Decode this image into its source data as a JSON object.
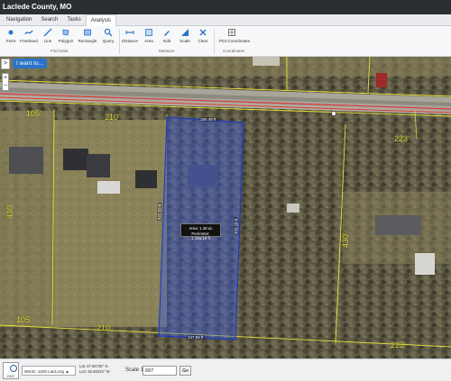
{
  "app": {
    "title": "Laclede County, MO"
  },
  "nav": {
    "tabs": [
      "Navigation",
      "Search",
      "Tasks",
      "Analysis"
    ],
    "active": "Analysis"
  },
  "ribbon": {
    "tools": [
      {
        "label": "Point",
        "icon": "point-icon"
      },
      {
        "label": "Freehand",
        "icon": "freehand-icon"
      },
      {
        "label": "Line",
        "icon": "line-icon"
      },
      {
        "label": "Polygon",
        "icon": "polygon-icon"
      },
      {
        "label": "Rectangle",
        "icon": "rectangle-icon"
      },
      {
        "label": "Query",
        "icon": "query-icon"
      },
      {
        "label": "Distance",
        "icon": "distance-icon"
      },
      {
        "label": "Area",
        "icon": "area-icon"
      },
      {
        "label": "Edit",
        "icon": "edit-icon"
      },
      {
        "label": "Scale",
        "icon": "scale-icon"
      },
      {
        "label": "Clear",
        "icon": "clear-icon"
      },
      {
        "label": "Plot Coordinates",
        "icon": "plot-coordinates-icon"
      }
    ],
    "groups": [
      "Find Data",
      "Measure",
      "Coordinates"
    ]
  },
  "map": {
    "i_want_to": "I want to...",
    "collapse": ">",
    "zoom_in": "+",
    "zoom_out": "−",
    "popup": {
      "area": "Area: 1.48 ac",
      "perimeter": "Perimeter: 1,164.19 ft"
    },
    "parcel_dims": {
      "top": "150.45 ft",
      "left": "422.53 ft",
      "right": "432.16 ft",
      "bottom": "147.84 ft"
    },
    "lot_dims": [
      "105'",
      "210'",
      "223'",
      "430'",
      "430'",
      "105'",
      "210'",
      "223'"
    ]
  },
  "status": {
    "year": "2022",
    "projection": "WKID: 4326 Lat/Long",
    "lat": "Lat: 37.66735° N",
    "lon": "Lon: 92.60222° W",
    "scale_label": "Scale 1:",
    "scale_value": "697",
    "go": "Go"
  },
  "colors": {
    "parcel_fill": "#3b5bdb",
    "lot_line": "#e8e23a",
    "road_line": "#d83a3a",
    "active_button": "#2a73c9"
  }
}
